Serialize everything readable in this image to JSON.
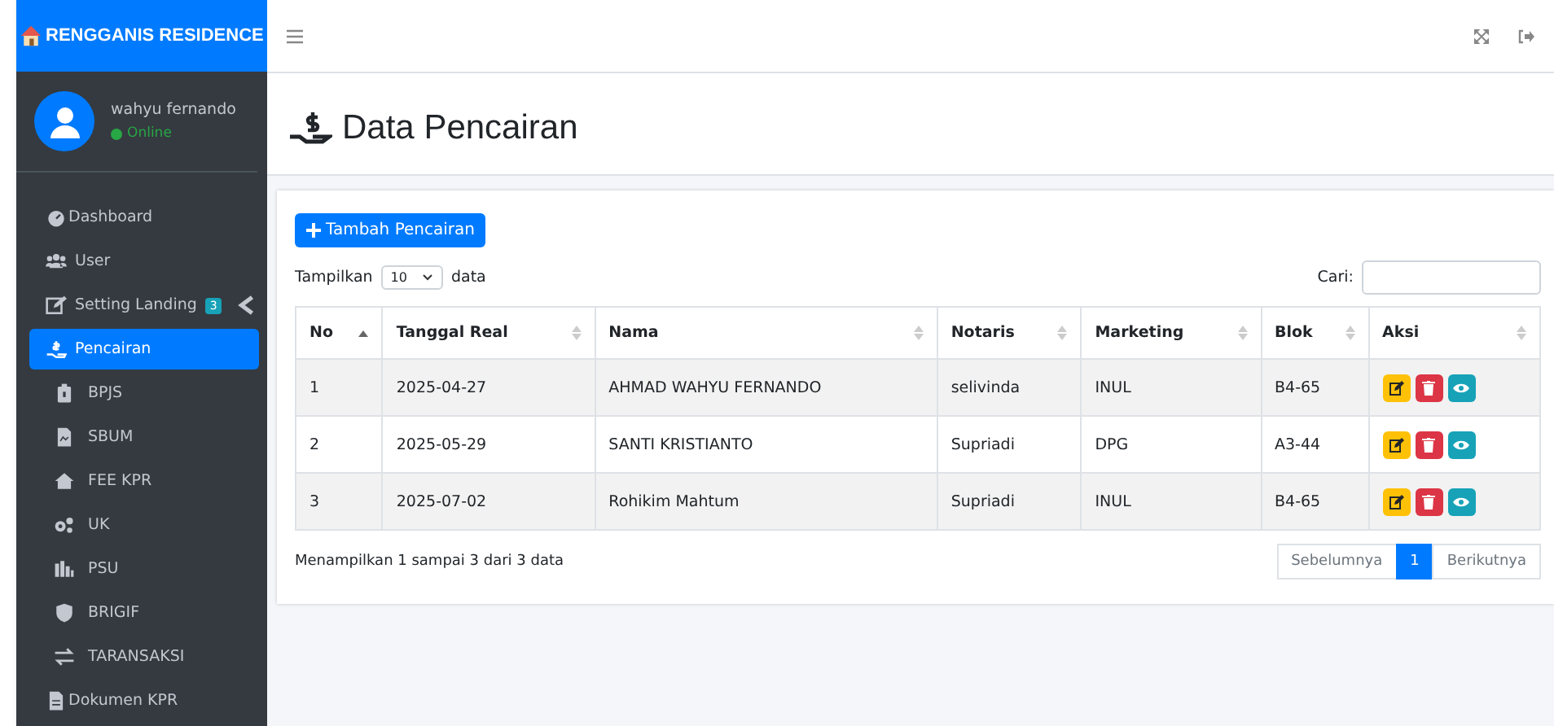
{
  "brand": {
    "title": "RENGGANIS RESIDENCE"
  },
  "user": {
    "name": "wahyu fernando",
    "status": "Online"
  },
  "sidebar": {
    "items": [
      {
        "label": "Dashboard",
        "kind": "top",
        "selected": false
      },
      {
        "label": "User",
        "kind": "item",
        "selected": false
      },
      {
        "label": "Setting Landing",
        "kind": "item",
        "selected": false,
        "badge": "3",
        "expanded": false
      },
      {
        "label": "Pencairan",
        "kind": "item",
        "selected": true
      },
      {
        "label": "BPJS",
        "kind": "sub",
        "selected": false
      },
      {
        "label": "SBUM",
        "kind": "sub",
        "selected": false
      },
      {
        "label": "FEE KPR",
        "kind": "sub",
        "selected": false
      },
      {
        "label": "UK",
        "kind": "sub",
        "selected": false
      },
      {
        "label": "PSU",
        "kind": "sub",
        "selected": false
      },
      {
        "label": "BRIGIF",
        "kind": "sub",
        "selected": false
      },
      {
        "label": "TARANSAKSI",
        "kind": "sub",
        "selected": false
      },
      {
        "label": "Dokumen KPR",
        "kind": "top",
        "selected": false
      }
    ]
  },
  "page": {
    "title": "Data Pencairan"
  },
  "add_button": "Tambah Pencairan",
  "length": {
    "label_before": "Tampilkan",
    "value": "10",
    "label_after": "data"
  },
  "search": {
    "label": "Cari:"
  },
  "table": {
    "columns": [
      {
        "label": "No",
        "sorted": true
      },
      {
        "label": "Tanggal Real",
        "sorted": false
      },
      {
        "label": "Nama",
        "sorted": false
      },
      {
        "label": "Notaris",
        "sorted": false
      },
      {
        "label": "Marketing",
        "sorted": false
      },
      {
        "label": "Blok",
        "sorted": false
      },
      {
        "label": "Aksi",
        "sorted": false
      }
    ],
    "rows": [
      [
        "1",
        "2025-04-27",
        "AHMAD WAHYU FERNANDO",
        "selivinda",
        "INUL",
        "B4-65"
      ],
      [
        "2",
        "2025-05-29",
        "SANTI KRISTIANTO",
        "Supriadi",
        "DPG",
        "A3-44"
      ],
      [
        "3",
        "2025-07-02",
        "Rohikim Mahtum",
        "Supriadi",
        "INUL",
        "B4-65"
      ]
    ]
  },
  "info": "Menampilkan 1 sampai 3 dari 3 data",
  "pagination": [
    {
      "label": "Sebelumnya",
      "selected": false,
      "disabled": true
    },
    {
      "label": "1",
      "selected": true,
      "disabled": false
    },
    {
      "label": "Berikutnya",
      "selected": false,
      "disabled": true
    }
  ]
}
